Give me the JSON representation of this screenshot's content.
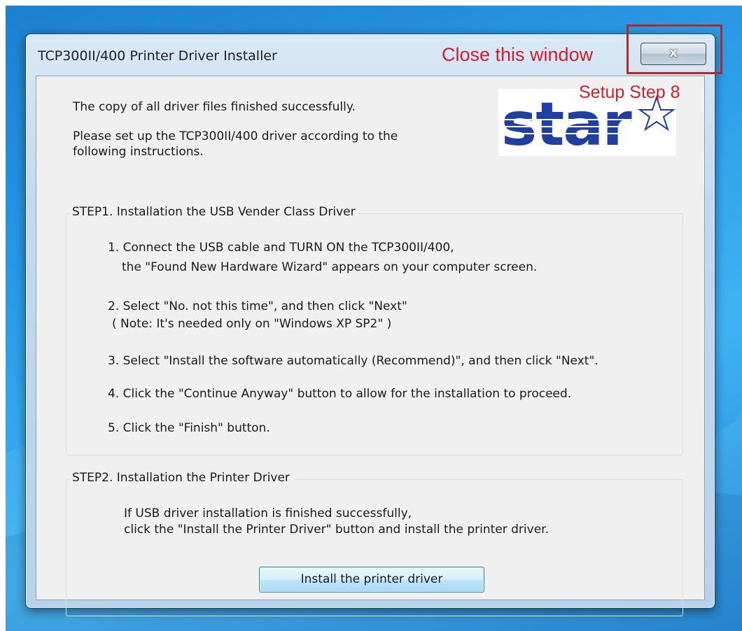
{
  "window": {
    "title": "TCP300II/400 Printer Driver Installer",
    "close_symbol": "x"
  },
  "annotations": {
    "close_label": "Close this window",
    "step_label": "Setup Step 8",
    "color": "#d01d2c"
  },
  "logo": {
    "text": "star",
    "icon": "star-logo",
    "color": "#1f3fa4"
  },
  "message": {
    "line1": "The copy of all driver files finished successfully.",
    "line2a": "Please set up the TCP300II/400 driver according to the",
    "line2b": "following instructions."
  },
  "step1": {
    "title": "STEP1.  Installation the USB Vender Class Driver",
    "items": [
      {
        "l1": "1. Connect the USB cable and TURN ON the TCP300II/400,",
        "l2": "the \"Found New Hardware Wizard\" appears on your computer screen."
      },
      {
        "l1": "2. Select \"No. not this time\", and then click \"Next\"",
        "l2": "( Note: It's needed only on \"Windows XP SP2\" )"
      },
      {
        "l1": "3. Select \"Install the software automatically (Recommend)\", and then click \"Next\"."
      },
      {
        "l1": "4. Click the \"Continue Anyway\" button to allow for the installation to proceed."
      },
      {
        "l1": "5. Click the \"Finish\" button."
      }
    ]
  },
  "step2": {
    "title": "STEP2.  Installation the Printer Driver",
    "line1": "If USB driver installation is finished successfully,",
    "line2": "click the \"Install the Printer Driver\" button and install the printer driver.",
    "button_label": "Install the printer driver"
  }
}
